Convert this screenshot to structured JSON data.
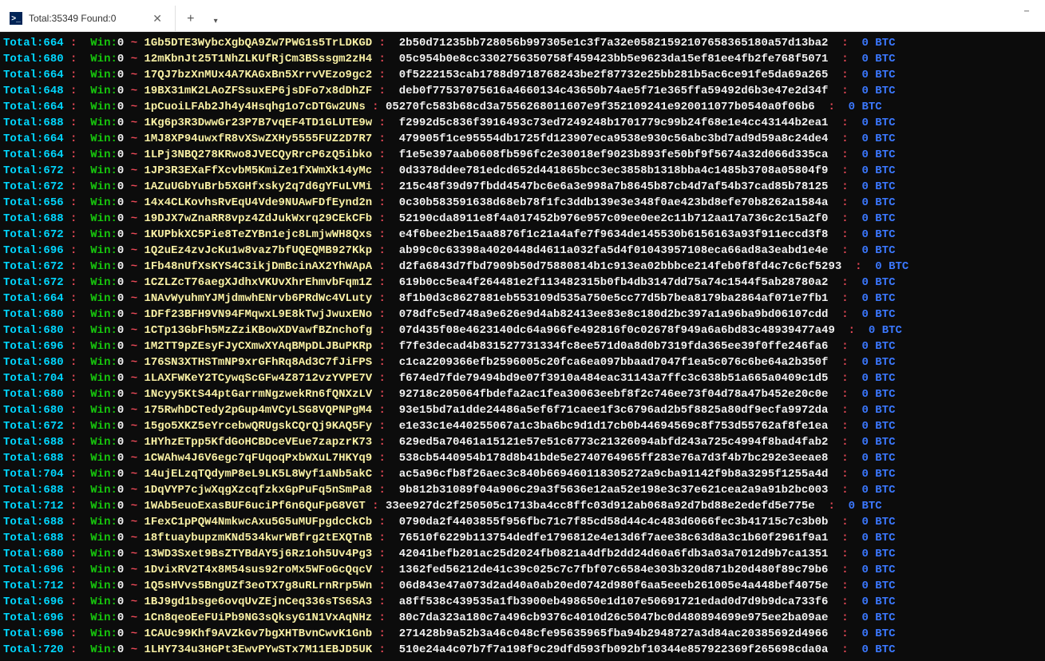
{
  "window": {
    "tab_title": "Total:35349 Found:0"
  },
  "rows": [
    {
      "t": 664,
      "addr": "1Gb5DTE3WybcXgbQA9Zw7PWG1s5TrLDKGD",
      "key": "2b50d71235bb728056b997305e1c3f7a32e05821592107658365180a57d13ba2"
    },
    {
      "t": 680,
      "addr": "12mKbnJt25T1NhZLKUfRjCm3BSssgm2zH4",
      "key": "05c954b0e8cc3302756350758f459423bb5e9623da15ef81ee4fb2fe768f5071"
    },
    {
      "t": 664,
      "addr": "17QJ7bzXnMUx4A7KAGxBn5XrrvVEzo9gc2",
      "key": "0f5222153cab1788d9718768243be2f87732e25bb281b5ac6ce91fe5da69a265"
    },
    {
      "t": 648,
      "addr": "19BX31mK2LAoZFSsuxEP6jsDFo7x8dDhZF",
      "key": "deb0f77537075616a4660134c43650b74ae5f71e365ffa59492d6b3e47e2d34f"
    },
    {
      "t": 664,
      "addr": "1pCuoiLFAb2Jh4y4Hsqhg1o7cDTGw2UNs",
      "key": "05270fc583b68cd3a7556268011607e9f352109241e920011077b0540a0f06b6",
      "short": true
    },
    {
      "t": 688,
      "addr": "1Kg6p3R3DwwGr23P7B7vqEF4TD1GLUTE9w",
      "key": "f2992d5c836f3916493c73ed7249248b1701779c99b24f68e1e4cc43144b2ea1"
    },
    {
      "t": 664,
      "addr": "1MJ8XP94uwxfR8vXSwZXHy5555FUZ2D7R7",
      "key": "479905f1ce95554db1725fd123907eca9538e930c56abc3bd7ad9d59a8c24de4"
    },
    {
      "t": 664,
      "addr": "1LPj3NBQ278KRwo8JVECQyRrcP6zQ5ibko",
      "key": "f1e5e397aab0608fb596fc2e30018ef9023b893fe50bf9f5674a32d066d335ca"
    },
    {
      "t": 672,
      "addr": "1JP3R3EXaFfXcvbM5KmiZe1fXWmXk14yMc",
      "key": "0d3378ddee781edcd652d441865bcc3ec3858b1318bba4c1485b3708a05804f9"
    },
    {
      "t": 672,
      "addr": "1AZuUGbYuBrb5XGHfxsky2q7d6gYFuLVMi",
      "key": "215c48f39d97fbdd4547bc6e6a3e998a7b8645b87cb4d7af54b37cad85b78125"
    },
    {
      "t": 656,
      "addr": "14x4CLKovhsRvEqU4Vde9NUAwFDfEynd2n",
      "key": "0c30b583591638d68eb78f1fc3ddb139e3e348f0ae423bd8efe70b8262a1584a"
    },
    {
      "t": 688,
      "addr": "19DJX7wZnaRR8vpz4ZdJukWxrq29CEkCFb",
      "key": "52190cda8911e8f4a017452b976e957c09ee0ee2c11b712aa17a736c2c15a2f0"
    },
    {
      "t": 672,
      "addr": "1KUPbkXC5Pie8TeZYBn1ejc8LmjwWH8Qxs",
      "key": "e4f6bee2be15aa8876f1c21a4afe7f9634de145530b6156163a93f911eccd3f8"
    },
    {
      "t": 696,
      "addr": "1Q2uEz4zvJcKu1w8vaz7bfUQEQMB927Kkp",
      "key": "ab99c0c63398a4020448d4611a032fa5d4f01043957108eca66ad8a3eabd1e4e"
    },
    {
      "t": 672,
      "addr": "1Fb48nUfXsKYS4C3ikjDmBcinAX2YhWApA",
      "key": "d2fa6843d7fbd7909b50d75880814b1c913ea02bbbce214feb0f8fd4c7c6cf5293"
    },
    {
      "t": 672,
      "addr": "1CZLZcT76aegXJdhxVKUvXhrEhmvbFqm1Z",
      "key": "619b0cc5ea4f264481e2f113482315b0fb4db3147dd75a74c1544f5ab28780a2"
    },
    {
      "t": 664,
      "addr": "1NAvWyuhmYJMjdmwhENrvb6PRdWc4VLuty",
      "key": "8f1b0d3c8627881eb553109d535a750e5cc77d5b7bea8179ba2864af071e7fb1"
    },
    {
      "t": 680,
      "addr": "1DFf23BFH9VN94FMqwxL9E8kTwjJwuxENo",
      "key": "078dfc5ed748a9e626e9d4ab82413ee83e8c180d2bc397a1a96ba9bd06107cdd"
    },
    {
      "t": 680,
      "addr": "1CTp13GbFh5MzZziKBowXDVawfBZnchofg",
      "key": "07d435f08e4623140dc64a966fe492816f0c02678f949a6a6bd83c48939477a49"
    },
    {
      "t": 696,
      "addr": "1M2TT9pZEsyFJyCXmwXYAqBMpDLJBuPKRp",
      "key": "f7fe3decad4b831527731334fc8ee571d0a8d0b7319fda365ee39f0ffe246fa6"
    },
    {
      "t": 680,
      "addr": "176SN3XTHSTmNP9xrGFhRq8Ad3C7fJiFPS",
      "key": "c1ca2209366efb2596005c20fca6ea097bbaad7047f1ea5c076c6be64a2b350f"
    },
    {
      "t": 704,
      "addr": "1LAXFWKeY2TCywqScGFw4Z8712vzYVPE7V",
      "key": "f674ed7fde79494bd9e07f3910a484eac31143a7ffc3c638b51a665a0409c1d5"
    },
    {
      "t": 680,
      "addr": "1Ncyy5KtS44ptGarrmNgzwekRn6fQNXzLV",
      "key": "92718c205064fbdefa2ac1fea30063eebf8f2c746ee73f04d78a47b452e20c0e"
    },
    {
      "t": 680,
      "addr": "175RwhDCTedy2pGup4mVCyLSG8VQPNPgM4",
      "key": "93e15bd7a1dde24486a5ef6f71caee1f3c6796ad2b5f8825a80df9ecfa9972da"
    },
    {
      "t": 672,
      "addr": "15go5XKZ5eYrcebwQRUgskCQrQj9KAQ5Fy",
      "key": "e1e33c1e440255067a1c3ba6bc9d1d17cb0b44694569c8f753d55762af8fe1ea"
    },
    {
      "t": 688,
      "addr": "1HYhzETpp5KfdGoHCBDceVEue7zapzrK73",
      "key": "629ed5a70461a15121e57e51c6773c21326094abfd243a725c4994f8bad4fab2"
    },
    {
      "t": 688,
      "addr": "1CWAhw4J6V6egc7qFUqoqPxbWXuL7HKYq9",
      "key": "538cb5440954b178d8b41bde5e2740764965ff283e76a7d3f4b7bc292e3eeae8"
    },
    {
      "t": 704,
      "addr": "14ujELzqTQdymP8eL9LK5L8Wyf1aNb5akC",
      "key": "ac5a96cfb8f26aec3c840b669460118305272a9cba91142f9b8a3295f1255a4d"
    },
    {
      "t": 688,
      "addr": "1DqVYP7cjwXqgXzcqfzkxGpPuFq5nSmPa8",
      "key": "9b812b31089f04a906c29a3f5636e12aa52e198e3c37e621cea2a9a91b2bc003"
    },
    {
      "t": 712,
      "addr": "1WAb5euoExasBUF6uciPf6n6QuFpG8VGT",
      "key": "33ee927dc2f250505c1713ba4cc8ffc03d912ab068a92d7bd88e2edefd5e775e",
      "short": true
    },
    {
      "t": 688,
      "addr": "1FexC1pPQW4NmkwcAxu5G5uMUFpgdcCkCb",
      "key": "0790da2f4403855f956fbc71c7f85cd58d44c4c483d6066fec3b41715c7c3b0b"
    },
    {
      "t": 688,
      "addr": "18ftuaybupzmKNd534kwrWBfrg2tEXQTnB",
      "key": "76510f6229b113754dedfe1796812e4e13d6f7aee38c63d8a3c1b60f2961f9a1"
    },
    {
      "t": 680,
      "addr": "13WD3Sxet9BsZTYBdAY5j6Rz1oh5Uv4Pg3",
      "key": "42041befb201ac25d2024fb0821a4dfb2dd24d60a6fdb3a03a7012d9b7ca1351"
    },
    {
      "t": 696,
      "addr": "1DvixRV2T4x8M54sus92roMx5WFoGcQqcV",
      "key": "1362fed56212de41c39c025c7c7fbf07c6584e303b320d871b20d480f89c79b6"
    },
    {
      "t": 712,
      "addr": "1Q5sHVvs5BngUZf3eoTX7g8uRLrnRrp5Wn",
      "key": "06d843e47a073d2ad40a0ab20ed0742d980f6aa5eeeb261005e4a448bef4075e"
    },
    {
      "t": 696,
      "addr": "1BJ9gd1bsge6ovqUvZEjnCeq336sTS6SA3",
      "key": "a8ff538c439535a1fb3900eb498650e1d107e50691721edad0d7d9b9dca733f6"
    },
    {
      "t": 696,
      "addr": "1Cn8qeoEeFUiPb9NG3sQksyG1N1VxAqNHz",
      "key": "80c7da323a180c7a496cb9376c4010d26c5047bc0d480894699e975ee2ba09ae"
    },
    {
      "t": 696,
      "addr": "1CAUc99Khf9AVZkGv7bgXHTBvnCwvK1Gnb",
      "key": "271428b9a52b3a46c048cfe95635965fba94b2948727a3d84ac20385692d4966"
    },
    {
      "t": 720,
      "addr": "1LHY734u3HGPt3EwvPYwSTx7M11EBJD5UK",
      "key": "510e24a4c07b7f7a198f9c29dfd593fb092bf10344e857922369f265698cda0a"
    }
  ],
  "static": {
    "total_label": "Total:",
    "win_label": "Win:",
    "win_value": "0",
    "sep": " : ",
    "tilde": "~ ",
    "amount": "0",
    "btc": "BTC"
  }
}
